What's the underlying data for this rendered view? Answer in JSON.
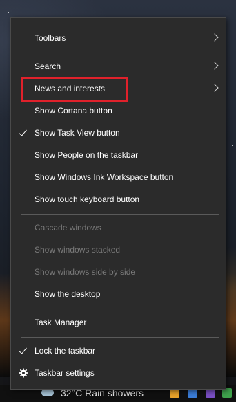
{
  "context_menu": {
    "items": [
      {
        "label": "Toolbars",
        "submenu": true
      },
      {
        "label": "Search",
        "submenu": true
      },
      {
        "label": "News and interests",
        "submenu": true,
        "highlighted": true
      },
      {
        "label": "Show Cortana button"
      },
      {
        "label": "Show Task View button",
        "checked": true
      },
      {
        "label": "Show People on the taskbar"
      },
      {
        "label": "Show Windows Ink Workspace button"
      },
      {
        "label": "Show touch keyboard button"
      },
      {
        "label": "Cascade windows",
        "disabled": true
      },
      {
        "label": "Show windows stacked",
        "disabled": true
      },
      {
        "label": "Show windows side by side",
        "disabled": true
      },
      {
        "label": "Show the desktop"
      },
      {
        "label": "Task Manager"
      },
      {
        "label": "Lock the taskbar",
        "checked": true
      },
      {
        "label": "Taskbar settings",
        "icon": "gear-icon"
      }
    ]
  },
  "taskbar": {
    "weather_text": "32°C  Rain showers"
  },
  "colors": {
    "menu_background": "#2b2b2b",
    "highlight_border": "#e0212b",
    "disabled_text": "#7a7a7a"
  }
}
